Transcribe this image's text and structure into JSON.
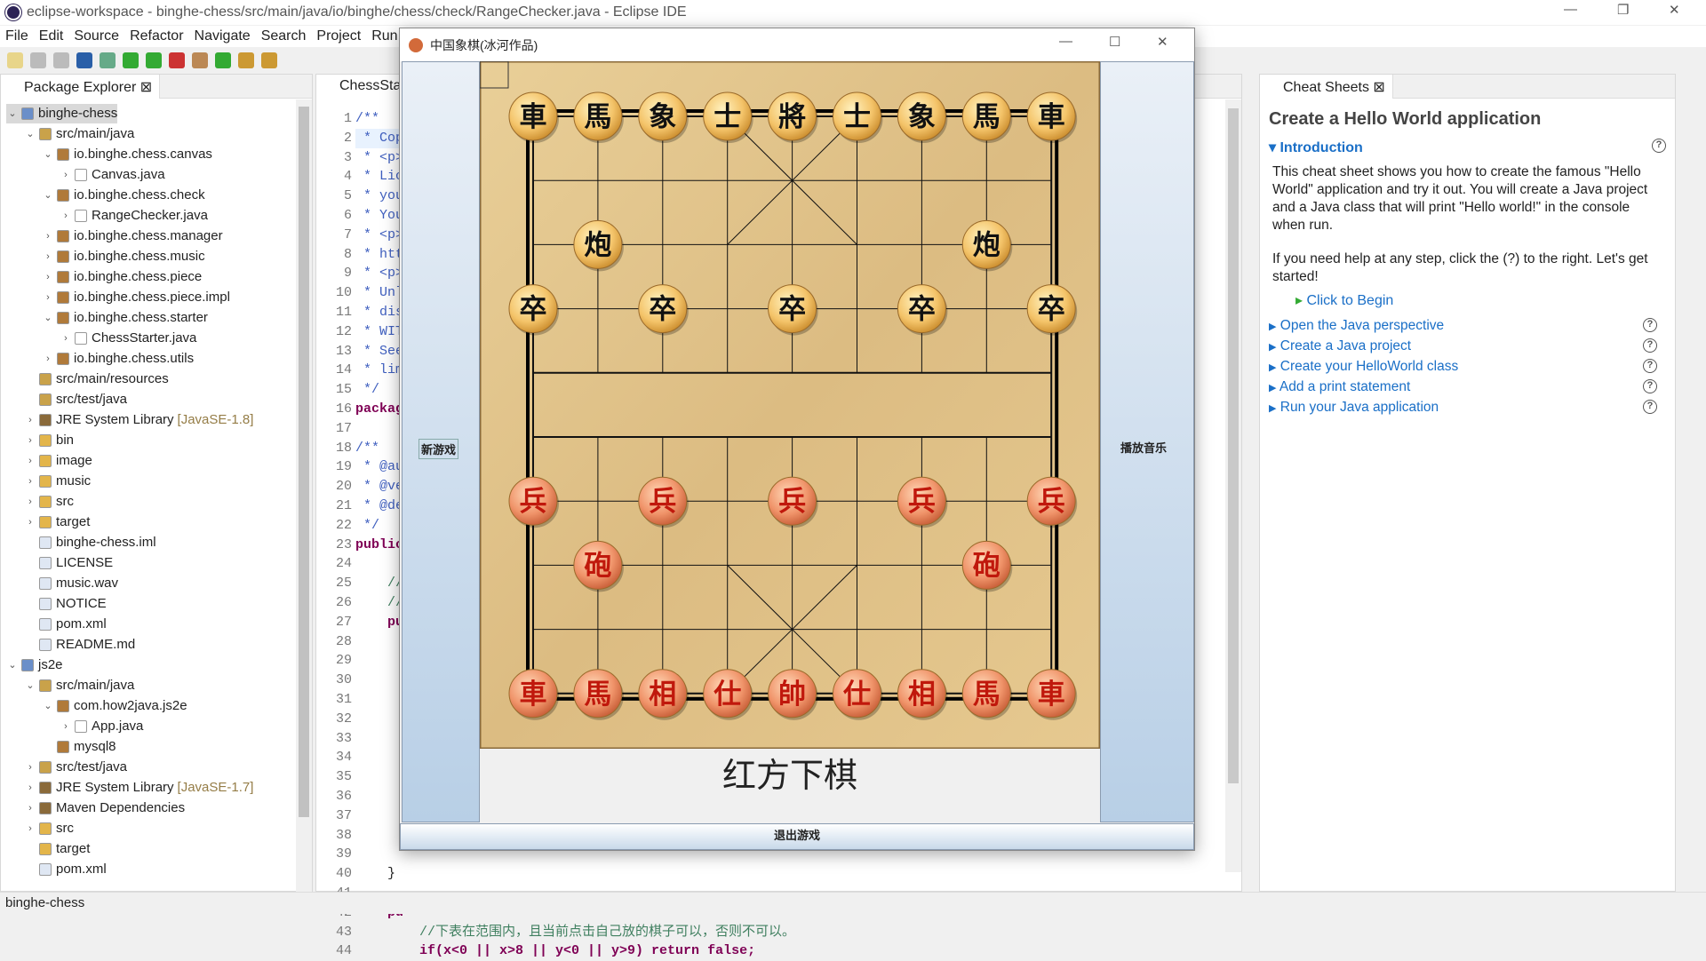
{
  "window": {
    "title": "eclipse-workspace - binghe-chess/src/main/java/io/binghe/chess/check/RangeChecker.java - Eclipse IDE",
    "minimize": "—",
    "restore": "❐",
    "close": "✕"
  },
  "menu": [
    "File",
    "Edit",
    "Source",
    "Refactor",
    "Navigate",
    "Search",
    "Project",
    "Run"
  ],
  "explorer": {
    "title": "Package Explorer",
    "items": [
      {
        "label": "binghe-chess",
        "level": 0,
        "tw": "v",
        "icon": "project-icon",
        "sel": true
      },
      {
        "label": "src/main/java",
        "level": 1,
        "tw": "v",
        "icon": "source-folder-icon"
      },
      {
        "label": "io.binghe.chess.canvas",
        "level": 2,
        "tw": "v",
        "icon": "package-icon"
      },
      {
        "label": "Canvas.java",
        "level": 3,
        "tw": ">",
        "icon": "java-file-icon"
      },
      {
        "label": "io.binghe.chess.check",
        "level": 2,
        "tw": "v",
        "icon": "package-icon"
      },
      {
        "label": "RangeChecker.java",
        "level": 3,
        "tw": ">",
        "icon": "java-file-icon"
      },
      {
        "label": "io.binghe.chess.manager",
        "level": 2,
        "tw": ">",
        "icon": "package-icon"
      },
      {
        "label": "io.binghe.chess.music",
        "level": 2,
        "tw": ">",
        "icon": "package-icon"
      },
      {
        "label": "io.binghe.chess.piece",
        "level": 2,
        "tw": ">",
        "icon": "package-icon"
      },
      {
        "label": "io.binghe.chess.piece.impl",
        "level": 2,
        "tw": ">",
        "icon": "package-icon"
      },
      {
        "label": "io.binghe.chess.starter",
        "level": 2,
        "tw": "v",
        "icon": "package-icon"
      },
      {
        "label": "ChessStarter.java",
        "level": 3,
        "tw": ">",
        "icon": "java-file-icon"
      },
      {
        "label": "io.binghe.chess.utils",
        "level": 2,
        "tw": ">",
        "icon": "package-icon"
      },
      {
        "label": "src/main/resources",
        "level": 1,
        "tw": "",
        "icon": "source-folder-icon"
      },
      {
        "label": "src/test/java",
        "level": 1,
        "tw": "",
        "icon": "source-folder-icon"
      },
      {
        "label": "JRE System Library",
        "dec": "[JavaSE-1.8]",
        "level": 1,
        "tw": ">",
        "icon": "library-icon"
      },
      {
        "label": "bin",
        "level": 1,
        "tw": ">",
        "icon": "folder-icon"
      },
      {
        "label": "image",
        "level": 1,
        "tw": ">",
        "icon": "folder-icon"
      },
      {
        "label": "music",
        "level": 1,
        "tw": ">",
        "icon": "folder-icon"
      },
      {
        "label": "src",
        "level": 1,
        "tw": ">",
        "icon": "folder-icon"
      },
      {
        "label": "target",
        "level": 1,
        "tw": ">",
        "icon": "folder-icon"
      },
      {
        "label": "binghe-chess.iml",
        "level": 1,
        "tw": "",
        "icon": "file-icon"
      },
      {
        "label": "LICENSE",
        "level": 1,
        "tw": "",
        "icon": "file-icon"
      },
      {
        "label": "music.wav",
        "level": 1,
        "tw": "",
        "icon": "file-icon"
      },
      {
        "label": "NOTICE",
        "level": 1,
        "tw": "",
        "icon": "file-icon"
      },
      {
        "label": "pom.xml",
        "level": 1,
        "tw": "",
        "icon": "file-icon"
      },
      {
        "label": "README.md",
        "level": 1,
        "tw": "",
        "icon": "file-icon"
      },
      {
        "label": "js2e",
        "level": 0,
        "tw": "v",
        "icon": "project-icon"
      },
      {
        "label": "src/main/java",
        "level": 1,
        "tw": "v",
        "icon": "source-folder-icon"
      },
      {
        "label": "com.how2java.js2e",
        "level": 2,
        "tw": "v",
        "icon": "package-icon"
      },
      {
        "label": "App.java",
        "level": 3,
        "tw": ">",
        "icon": "java-file-icon"
      },
      {
        "label": "mysql8",
        "level": 2,
        "tw": "",
        "icon": "package-icon"
      },
      {
        "label": "src/test/java",
        "level": 1,
        "tw": ">",
        "icon": "source-folder-icon"
      },
      {
        "label": "JRE System Library",
        "dec": "[JavaSE-1.7]",
        "level": 1,
        "tw": ">",
        "icon": "library-icon"
      },
      {
        "label": "Maven Dependencies",
        "level": 1,
        "tw": ">",
        "icon": "library-icon"
      },
      {
        "label": "src",
        "level": 1,
        "tw": ">",
        "icon": "folder-icon"
      },
      {
        "label": "target",
        "level": 1,
        "tw": "",
        "icon": "folder-icon"
      },
      {
        "label": "pom.xml",
        "level": 1,
        "tw": "",
        "icon": "file-icon"
      }
    ]
  },
  "editor": {
    "tab": "ChessStar",
    "lines": [
      [
        "/**",
        "cm"
      ],
      [
        " * Cop",
        "cm"
      ],
      [
        " * <p>",
        "cm"
      ],
      [
        " * Lic",
        "cm"
      ],
      [
        " * you",
        "cm"
      ],
      [
        " * You",
        "cm"
      ],
      [
        " * <p>",
        "cm"
      ],
      [
        " * htt",
        "cm"
      ],
      [
        " * <p>",
        "cm"
      ],
      [
        " * Unl",
        "cm"
      ],
      [
        " * dis",
        "cm"
      ],
      [
        " * WIT",
        "cm"
      ],
      [
        " * See",
        "cm"
      ],
      [
        " * lim",
        "cm"
      ],
      [
        " */",
        "cm"
      ],
      [
        "packag",
        "kw"
      ],
      [
        "",
        ""
      ],
      [
        "/**",
        "cm"
      ],
      [
        " * @au",
        "cm"
      ],
      [
        " * @ve",
        "cm"
      ],
      [
        " * @de",
        "cm"
      ],
      [
        " */",
        "cm"
      ],
      [
        "public",
        "kw"
      ],
      [
        "",
        ""
      ],
      [
        "    //",
        "gc"
      ],
      [
        "    //",
        "gc"
      ],
      [
        "    pu",
        "kw"
      ],
      [
        "",
        ""
      ],
      [
        "",
        ""
      ],
      [
        "",
        ""
      ],
      [
        "",
        ""
      ],
      [
        "",
        ""
      ],
      [
        "",
        ""
      ],
      [
        "",
        ""
      ],
      [
        "",
        ""
      ],
      [
        "",
        ""
      ],
      [
        "",
        ""
      ],
      [
        "",
        ""
      ],
      [
        "",
        ""
      ],
      [
        "    }",
        ""
      ],
      [
        "",
        ""
      ],
      [
        "    pu",
        "kw"
      ],
      [
        "        //下表在范围内，且当前点击自己放的棋子可以，否则不可以。",
        "gc"
      ],
      [
        "        if(x<0 || x>8 || y<0 || y>9) return false;",
        "kw"
      ]
    ]
  },
  "cheat": {
    "tab": "Cheat Sheets",
    "title": "Create a Hello World application",
    "intro": "Introduction",
    "p1": "This cheat sheet shows you how to create the famous \"Hello World\" application and try it out. You will create a Java project and a Java class that will print \"Hello world!\" in the console when run.",
    "p2": "If you need help at any step, click the (?) to the right. Let's get started!",
    "begin": "Click to Begin",
    "steps": [
      "Open the Java perspective",
      "Create a Java project",
      "Create your HelloWorld class",
      "Add a print statement",
      "Run your Java application"
    ]
  },
  "chess": {
    "title": "中国象棋(冰河作品)",
    "new_game": "新游戏",
    "play_music": "播放音乐",
    "exit": "退出游戏",
    "status": "红方下棋",
    "colors": {
      "board": "#e2c48c",
      "black_text": "#111111",
      "red_text": "#c0180c"
    },
    "pieces": [
      {
        "c": "車",
        "x": 0,
        "y": 0,
        "side": "black"
      },
      {
        "c": "馬",
        "x": 1,
        "y": 0,
        "side": "black"
      },
      {
        "c": "象",
        "x": 2,
        "y": 0,
        "side": "black"
      },
      {
        "c": "士",
        "x": 3,
        "y": 0,
        "side": "black"
      },
      {
        "c": "將",
        "x": 4,
        "y": 0,
        "side": "black"
      },
      {
        "c": "士",
        "x": 5,
        "y": 0,
        "side": "black"
      },
      {
        "c": "象",
        "x": 6,
        "y": 0,
        "side": "black"
      },
      {
        "c": "馬",
        "x": 7,
        "y": 0,
        "side": "black"
      },
      {
        "c": "車",
        "x": 8,
        "y": 0,
        "side": "black"
      },
      {
        "c": "炮",
        "x": 1,
        "y": 2,
        "side": "black"
      },
      {
        "c": "炮",
        "x": 7,
        "y": 2,
        "side": "black"
      },
      {
        "c": "卒",
        "x": 0,
        "y": 3,
        "side": "black"
      },
      {
        "c": "卒",
        "x": 2,
        "y": 3,
        "side": "black"
      },
      {
        "c": "卒",
        "x": 4,
        "y": 3,
        "side": "black"
      },
      {
        "c": "卒",
        "x": 6,
        "y": 3,
        "side": "black"
      },
      {
        "c": "卒",
        "x": 8,
        "y": 3,
        "side": "black"
      },
      {
        "c": "兵",
        "x": 0,
        "y": 6,
        "side": "red"
      },
      {
        "c": "兵",
        "x": 2,
        "y": 6,
        "side": "red"
      },
      {
        "c": "兵",
        "x": 4,
        "y": 6,
        "side": "red"
      },
      {
        "c": "兵",
        "x": 6,
        "y": 6,
        "side": "red"
      },
      {
        "c": "兵",
        "x": 8,
        "y": 6,
        "side": "red"
      },
      {
        "c": "砲",
        "x": 1,
        "y": 7,
        "side": "red"
      },
      {
        "c": "砲",
        "x": 7,
        "y": 7,
        "side": "red"
      },
      {
        "c": "車",
        "x": 0,
        "y": 9,
        "side": "red"
      },
      {
        "c": "馬",
        "x": 1,
        "y": 9,
        "side": "red"
      },
      {
        "c": "相",
        "x": 2,
        "y": 9,
        "side": "red"
      },
      {
        "c": "仕",
        "x": 3,
        "y": 9,
        "side": "red"
      },
      {
        "c": "帥",
        "x": 4,
        "y": 9,
        "side": "red"
      },
      {
        "c": "仕",
        "x": 5,
        "y": 9,
        "side": "red"
      },
      {
        "c": "相",
        "x": 6,
        "y": 9,
        "side": "red"
      },
      {
        "c": "馬",
        "x": 7,
        "y": 9,
        "side": "red"
      },
      {
        "c": "車",
        "x": 8,
        "y": 9,
        "side": "red"
      }
    ]
  },
  "statusbar": {
    "text": "binghe-chess"
  }
}
